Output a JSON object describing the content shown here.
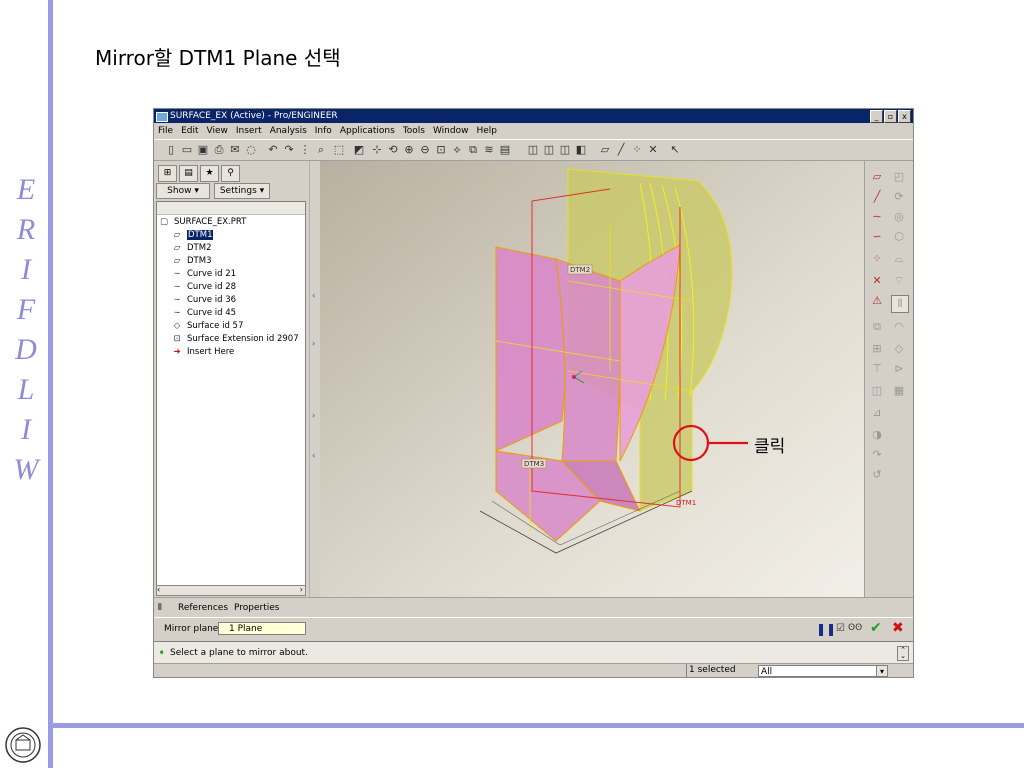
{
  "slide": {
    "title": "Mirror할 DTM1 Plane 선택",
    "side_letters": [
      "W",
      "I",
      "L",
      "D",
      "F",
      "I",
      "R",
      "E"
    ],
    "callout": "클릭"
  },
  "window": {
    "title": "SURFACE_EX (Active) - Pro/ENGINEER",
    "controls": [
      "_",
      "▫",
      "x"
    ]
  },
  "menu": [
    "File",
    "Edit",
    "View",
    "Insert",
    "Analysis",
    "Info",
    "Applications",
    "Tools",
    "Window",
    "Help"
  ],
  "panel": {
    "show_label": "Show",
    "settings_label": "Settings",
    "tree": [
      {
        "label": "SURFACE_EX.PRT",
        "icon": "part-icon",
        "selected": false
      },
      {
        "label": "DTM1",
        "icon": "datum-plane-icon",
        "selected": true
      },
      {
        "label": "DTM2",
        "icon": "datum-plane-icon",
        "selected": false
      },
      {
        "label": "DTM3",
        "icon": "datum-plane-icon",
        "selected": false
      },
      {
        "label": "Curve id 21",
        "icon": "curve-icon",
        "selected": false
      },
      {
        "label": "Curve id 28",
        "icon": "curve-icon",
        "selected": false
      },
      {
        "label": "Curve id 36",
        "icon": "curve-icon",
        "selected": false
      },
      {
        "label": "Curve id 45",
        "icon": "curve-icon",
        "selected": false
      },
      {
        "label": "Surface id 57",
        "icon": "surface-icon",
        "selected": false
      },
      {
        "label": "Surface Extension id 2907",
        "icon": "surface-extension-icon",
        "selected": false
      },
      {
        "label": "Insert Here",
        "icon": "insert-arrow-icon",
        "selected": false
      }
    ]
  },
  "viewport": {
    "datum_labels": [
      "DTM2",
      "DTM3",
      "DTM1"
    ]
  },
  "dashboard": {
    "tabs": [
      "References",
      "Properties"
    ],
    "mirror_plane_label": "Mirror plane",
    "mirror_plane_value": "1 Plane"
  },
  "message": "Select a plane to mirror about.",
  "status": {
    "selected": "1 selected",
    "filter": "All"
  },
  "colors": {
    "accent_stripe": "#9a9ae6",
    "title_bar": "#0a246a",
    "callout_red": "#e0101a",
    "surface_pink": "#d888c8",
    "surface_yellow": "#c8c860"
  }
}
